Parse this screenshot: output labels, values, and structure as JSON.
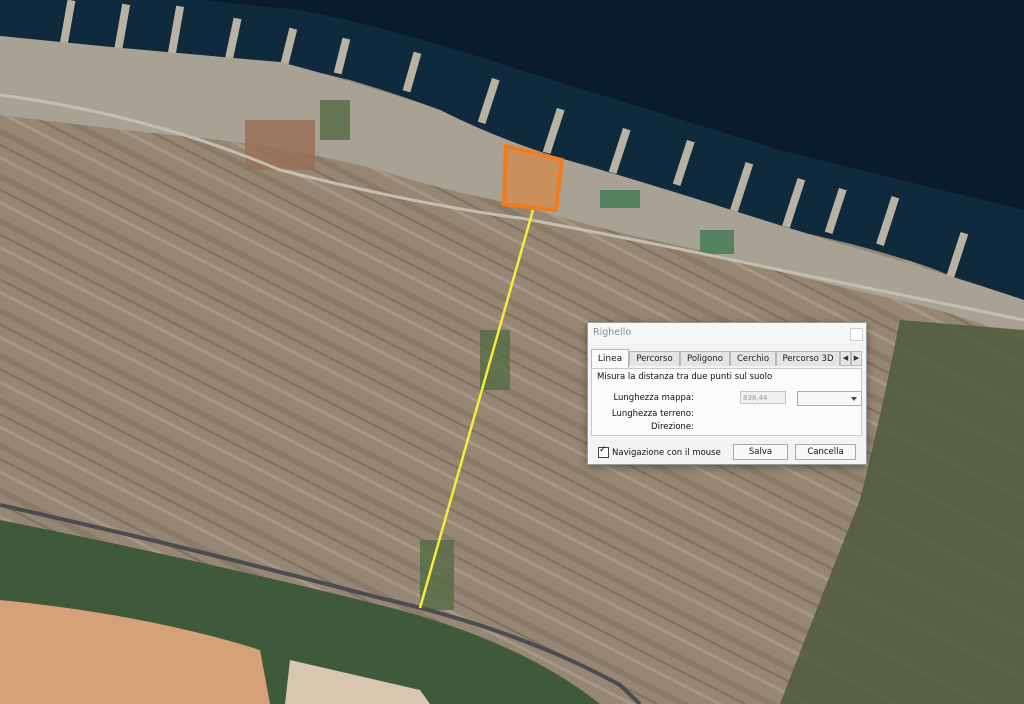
{
  "map": {
    "colors": {
      "sea": "#0d2536",
      "sea_deep": "#07192a",
      "land": "#968674",
      "highlight": "#f07c1e",
      "ruler_line": "#f6ec3b"
    }
  },
  "dialog": {
    "title": "Righello",
    "tabs": [
      {
        "label": "Linea",
        "active": true
      },
      {
        "label": "Percorso",
        "active": false
      },
      {
        "label": "Poligono",
        "active": false
      },
      {
        "label": "Cerchio",
        "active": false
      },
      {
        "label": "Percorso 3D",
        "active": false
      }
    ],
    "tab_scroll_left_icon": "chevron-left-icon",
    "tab_scroll_right_icon": "chevron-right-icon",
    "description": "Misura la distanza tra due punti sul suolo",
    "map_length_label": "Lunghezza mappa:",
    "ground_length_label": "Lunghezza terreno:",
    "direction_label": "Direzione:",
    "map_length_value": "838,44",
    "unit_select_value": "",
    "mouse_nav_label": "Navigazione con il mouse",
    "mouse_nav_checked": true,
    "save_button": "Salva",
    "cancel_button": "Cancella"
  }
}
